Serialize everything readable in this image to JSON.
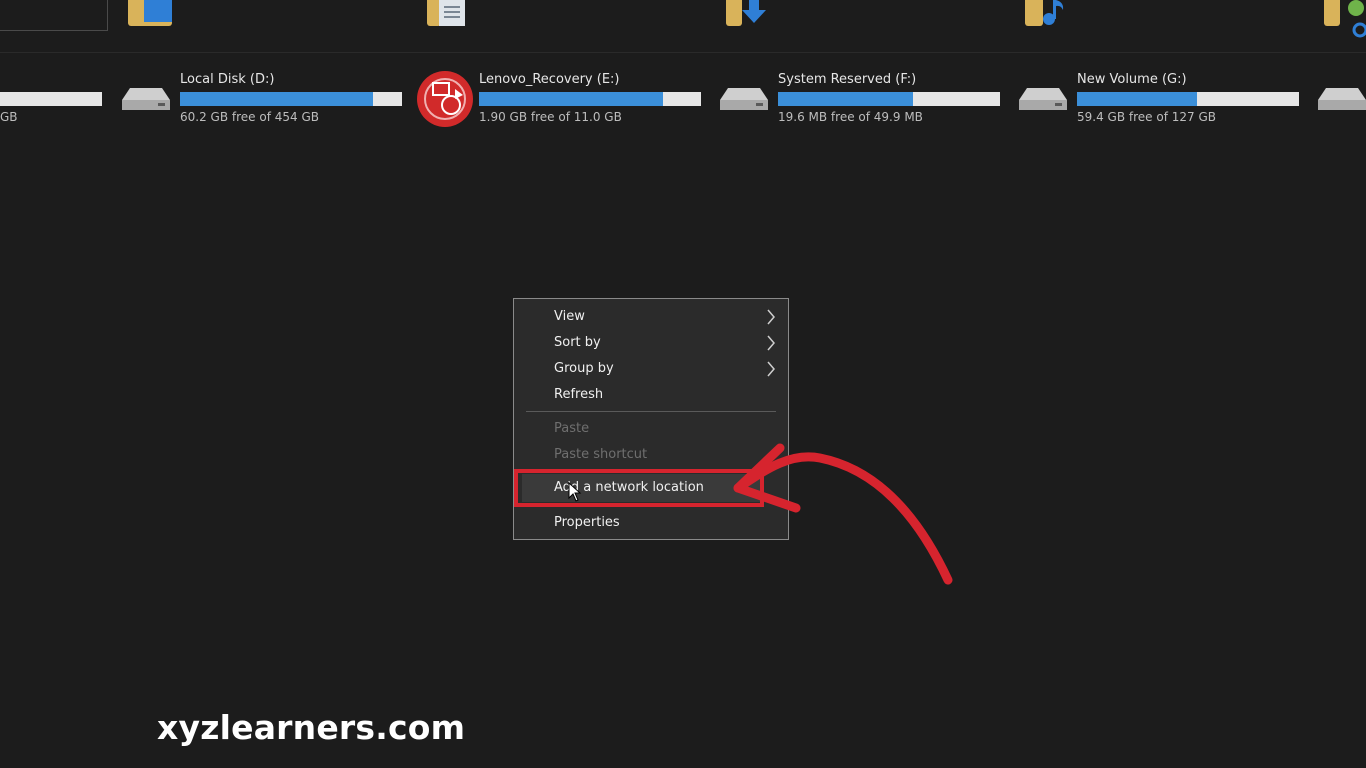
{
  "drives": [
    {
      "label": "",
      "free": "GB",
      "used_fraction": 0.27
    },
    {
      "label": "Local Disk (D:)",
      "free": "60.2 GB free of 454 GB",
      "used_fraction": 0.87
    },
    {
      "label": "Lenovo_Recovery (E:)",
      "free": "1.90 GB free of 11.0 GB",
      "used_fraction": 0.83
    },
    {
      "label": "System Reserved (F:)",
      "free": "19.6 MB free of 49.9 MB",
      "used_fraction": 0.61
    },
    {
      "label": "New Volume (G:)",
      "free": "59.4 GB free of 127 GB",
      "used_fraction": 0.54
    }
  ],
  "context_menu": {
    "items": [
      {
        "label": "View",
        "has_submenu": true,
        "disabled": false
      },
      {
        "label": "Sort by",
        "has_submenu": true,
        "disabled": false
      },
      {
        "label": "Group by",
        "has_submenu": true,
        "disabled": false
      },
      {
        "label": "Refresh",
        "has_submenu": false,
        "disabled": false
      },
      {
        "label": "Paste",
        "has_submenu": false,
        "disabled": true
      },
      {
        "label": "Paste shortcut",
        "has_submenu": false,
        "disabled": true
      },
      {
        "label": "Add a network location",
        "has_submenu": false,
        "disabled": false,
        "highlighted": true
      },
      {
        "label": "Properties",
        "has_submenu": false,
        "disabled": false
      }
    ]
  },
  "watermark": "xyzlearners.com",
  "colors": {
    "background": "#1c1c1c",
    "bar_fill": "#3b8fd9",
    "bar_track": "#e6e6e6",
    "annotation_red": "#d6242e"
  },
  "icons": {
    "drive": "hard-drive-icon",
    "recovery": "lenovo-recovery-icon",
    "folder": "folder-icon",
    "submenu": "chevron-right-icon",
    "cursor": "mouse-pointer-icon"
  }
}
